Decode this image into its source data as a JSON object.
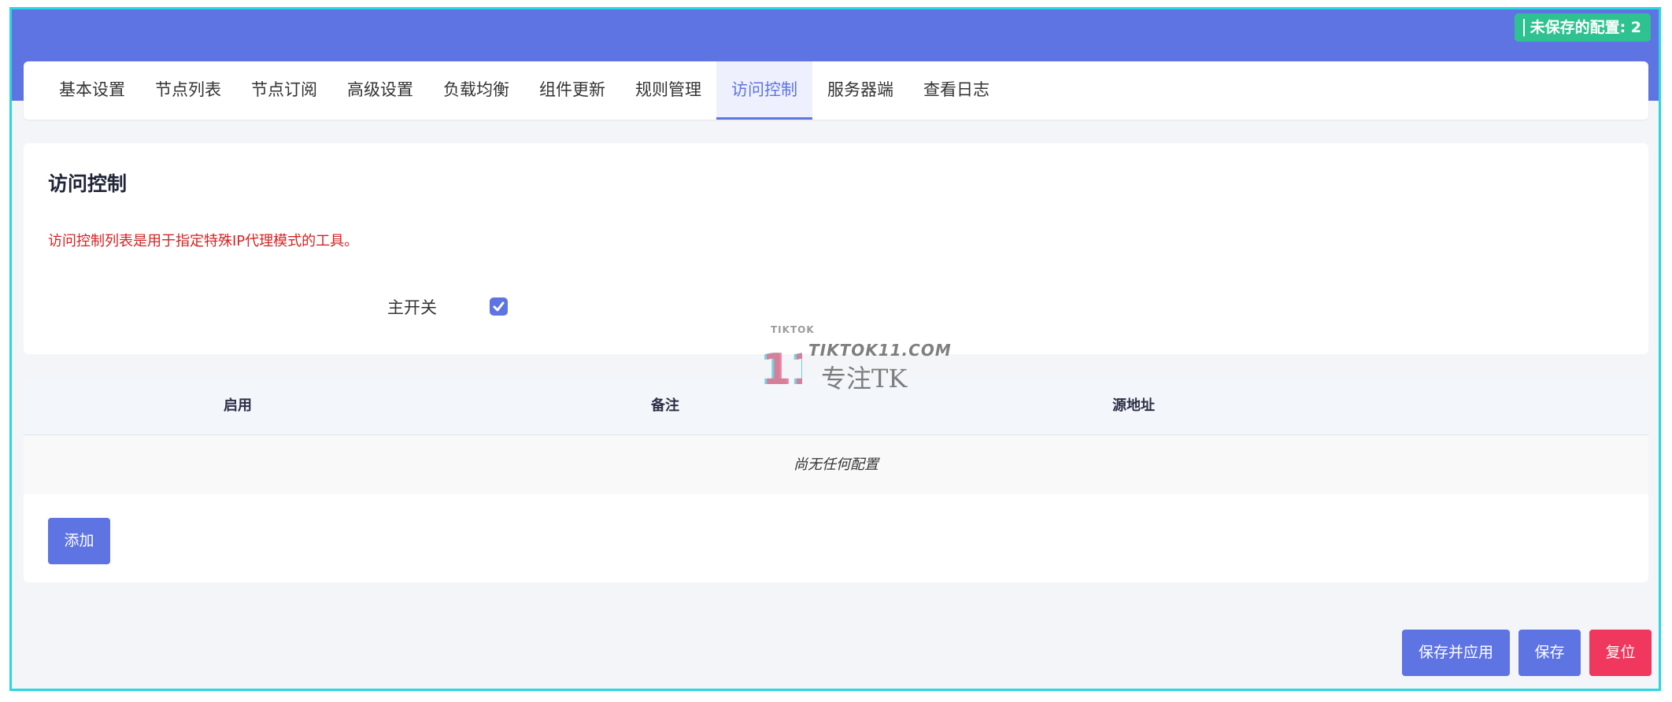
{
  "header": {
    "unsaved_badge": "未保存的配置: 2"
  },
  "tabs": [
    {
      "label": "基本设置",
      "active": false
    },
    {
      "label": "节点列表",
      "active": false
    },
    {
      "label": "节点订阅",
      "active": false
    },
    {
      "label": "高级设置",
      "active": false
    },
    {
      "label": "负载均衡",
      "active": false
    },
    {
      "label": "组件更新",
      "active": false
    },
    {
      "label": "规则管理",
      "active": false
    },
    {
      "label": "访问控制",
      "active": true
    },
    {
      "label": "服务器端",
      "active": false
    },
    {
      "label": "查看日志",
      "active": false
    }
  ],
  "section": {
    "title": "访问控制",
    "description": "访问控制列表是用于指定特殊IP代理模式的工具。",
    "main_switch_label": "主开关",
    "main_switch_checked": true
  },
  "table": {
    "columns": [
      "启用",
      "备注",
      "源地址"
    ],
    "empty_text": "尚无任何配置",
    "add_label": "添加"
  },
  "actions": {
    "save_apply_label": "保存并应用",
    "save_label": "保存",
    "reset_label": "复位"
  },
  "watermark": {
    "top_text": "TIKTOK",
    "site_text": "TIKTOK11.COM",
    "slogan_text": "专注TK",
    "logo_numeral": "11"
  },
  "colors": {
    "primary": "#5e74e3",
    "success": "#2ec291",
    "danger": "#f0375e",
    "warning_text": "#d62222",
    "frame_border": "#2ad6e3"
  }
}
